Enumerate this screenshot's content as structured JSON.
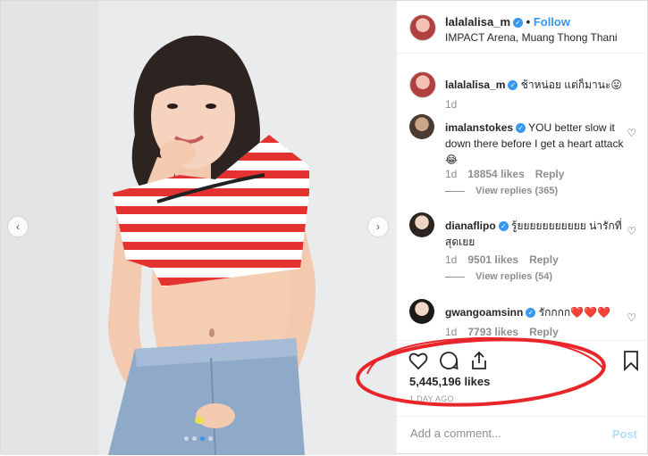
{
  "post": {
    "username": "lalalalisa_m",
    "verified_icon": "verified-badge-icon",
    "separator": "•",
    "follow_label": "Follow",
    "location": "IMPACT Arena, Muang Thong Thani"
  },
  "caption": {
    "username": "lalalalisa_m",
    "text": "ช้าหน่อย แต่ก็มานะ😛",
    "time": "1d"
  },
  "comments": [
    {
      "username": "imalanstokes",
      "text": "YOU better slow it down there before I get a heart attack 😂",
      "time": "1d",
      "likes": "18854 likes",
      "reply_label": "Reply",
      "view_replies": "View replies (365)"
    },
    {
      "username": "dianaflipo",
      "text": "รู้ยยยยยยยยยยย น่ารักที่สุดเยย",
      "time": "1d",
      "likes": "9501 likes",
      "reply_label": "Reply",
      "view_replies": "View replies (54)"
    },
    {
      "username": "gwangoamsinn",
      "text": "รักกกก❤️❤️❤️",
      "time": "1d",
      "likes": "7793 likes",
      "reply_label": "Reply"
    }
  ],
  "actions": {
    "like_icon": "heart-icon",
    "comment_icon": "comment-icon",
    "share_icon": "share-icon",
    "save_icon": "bookmark-icon",
    "likes_count": "5,445,196 likes",
    "posted_ago": "1 DAY AGO"
  },
  "add_comment": {
    "placeholder": "Add a comment...",
    "post_label": "Post"
  },
  "carousel": {
    "prev_glyph": "‹",
    "next_glyph": "›",
    "slide_count": 4,
    "active_slide": 3
  },
  "colors": {
    "accent": "#3897f0",
    "annotation_red": "#e8262a",
    "post_disabled": "#b2dffc"
  }
}
